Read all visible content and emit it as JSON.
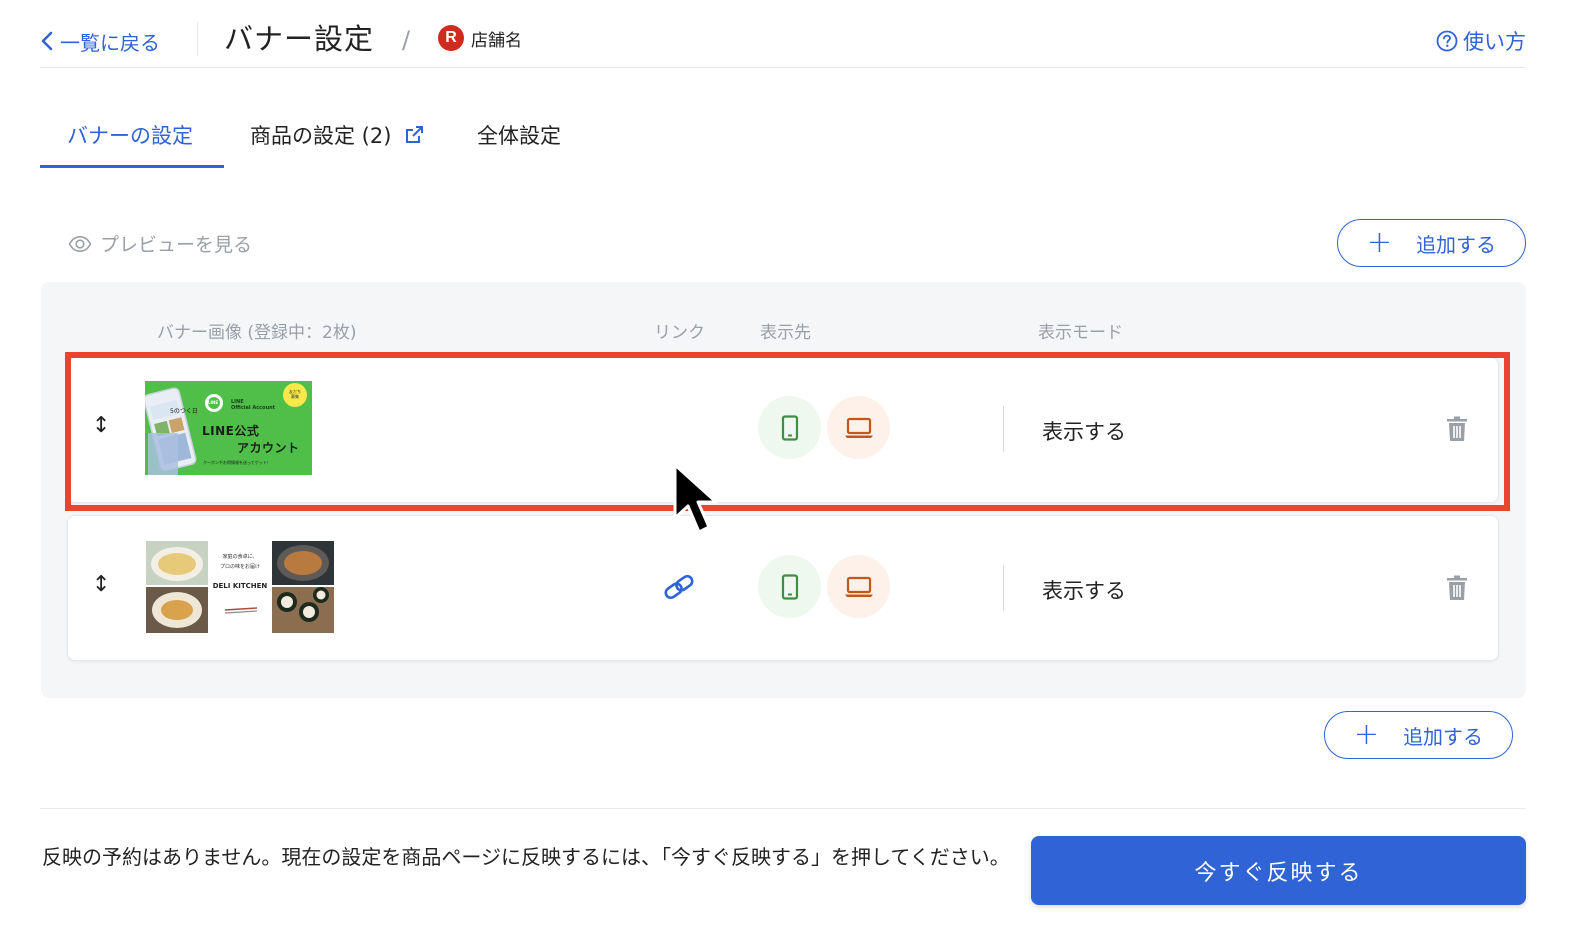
{
  "header": {
    "back_label": "一覧に戻る",
    "title": "バナー設定",
    "breadcrumb_sep": "/",
    "store_logo_letter": "R",
    "store_name": "店舗名",
    "help_label": "使い方"
  },
  "tabs": [
    {
      "label": "バナーの設定",
      "active": true
    },
    {
      "label": "商品の設定 (2)",
      "active": false,
      "icon": "external-link-icon"
    },
    {
      "label": "全体設定",
      "active": false
    }
  ],
  "toolbar": {
    "preview_label": "プレビューを見る",
    "add_label": "追加する",
    "add_plus": "+"
  },
  "table": {
    "columns": {
      "image": "バナー画像 (登録中：2枚)",
      "link": "リンク",
      "target": "表示先",
      "mode": "表示モード"
    },
    "rows": [
      {
        "drag_glyph": "↕",
        "banner": {
          "badge": "友だち\n募集",
          "line_logo": "LINE",
          "account": "LINE\nOfficial Account",
          "headline1": "LINE公式",
          "headline2": "アカウント",
          "sub": "クーポンやお得情報を送ってゲット！",
          "phone_text": "5のつく日"
        },
        "has_link": false,
        "mode": "表示する",
        "highlighted": true
      },
      {
        "drag_glyph": "↕",
        "banner": {
          "tagline1": "家庭の食卓に、",
          "tagline2": "プロの味をお届け",
          "brand": "DELI KITCHEN"
        },
        "has_link": true,
        "mode": "表示する",
        "highlighted": false
      }
    ]
  },
  "footer": {
    "message": "反映の予約はありません。現在の設定を商品ページに反映するには、「今すぐ反映する」を押してください。",
    "publish_label": "今すぐ反映する"
  },
  "colors": {
    "primary": "#2f63d6",
    "highlight": "#e8442e",
    "mobile_green": "#3d8f41",
    "pc_orange": "#c2571b",
    "banner_green": "#4fbf4a"
  }
}
